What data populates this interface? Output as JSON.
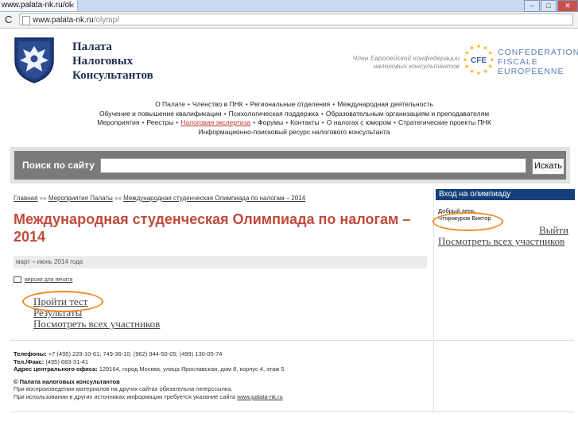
{
  "browser": {
    "tab_title": "www.palata-nk.ru/ol",
    "url_host": "www.palata-nk.ru",
    "url_path": "/olymp/"
  },
  "header": {
    "logo_lines": [
      "Палата",
      "Налоговых",
      "Консультантов"
    ],
    "cfe_caption": "Член Европейской конфедерации налоговых консультантов",
    "cfe_name": [
      "CONFEDERATION",
      "FISCALE",
      "EUROPEENNE"
    ],
    "cfe_badge": "CFE"
  },
  "nav": {
    "row1": [
      "О Палате",
      "Членство в ПНК",
      "Региональные отделения",
      "Международная деятельность"
    ],
    "row2": [
      "Обучение и повышение квалификации",
      "Психологическая поддержка",
      "Образовательным организациям и преподавателям"
    ],
    "row3": [
      "Мероприятия",
      "Реестры",
      "Налоговая экспертиза",
      "Форумы",
      "Контакты",
      "О налогах с юмором",
      "Стратегические проекты ПНК"
    ],
    "row4": "Информационно-поисковый ресурс налогового консультанта"
  },
  "search": {
    "label": "Поиск по сайту",
    "button": "Искать",
    "value": ""
  },
  "breadcrumb": {
    "home": "Главная",
    "sep": "»»",
    "events": "Мероприятия Палаты",
    "current": "Международная студенческая Олимпиада по налогам – 2014"
  },
  "main": {
    "title": "Международная студенческая Олимпиада по налогам – 2014",
    "dates": "март – июнь 2014 года",
    "print_link": "версия для печати",
    "links": [
      "Пройти тест",
      "Результаты",
      "Посмотреть всех участников"
    ]
  },
  "sidebar": {
    "heading": "Вход на олимпиаду",
    "greeting": "Добрый день,",
    "user": "Чторокуров Виктор",
    "logout": "Выйти",
    "all_participants": "Посмотреть всех участников"
  },
  "footer": {
    "phones_label": "Телефоны:",
    "phones": "+7 (495) 229-10-61; 749-36-10; (962) 944-50-05; (499) 130-05-74",
    "fax_label": "Тел./Факс:",
    "fax": "(495) 683-31-41",
    "address_label": "Адрес центрального офиса:",
    "address": "129164, город Москва, улица Ярославская, дом 8, корпус 4, этаж 5",
    "copyright": "© Палата налоговых консультантов",
    "note1": "При воспроизведении материалов на других сайтах обязательна гиперссылка.",
    "note2_text": "При использовании в других источниках информации требуется указание сайта",
    "note2_link": "www.palata-nk.ru"
  },
  "colors": {
    "title_red": "#c04a3a",
    "sidebar_header": "#153f7a",
    "highlight_oval": "#f08a24",
    "logo_navy": "#1f2c4c"
  }
}
